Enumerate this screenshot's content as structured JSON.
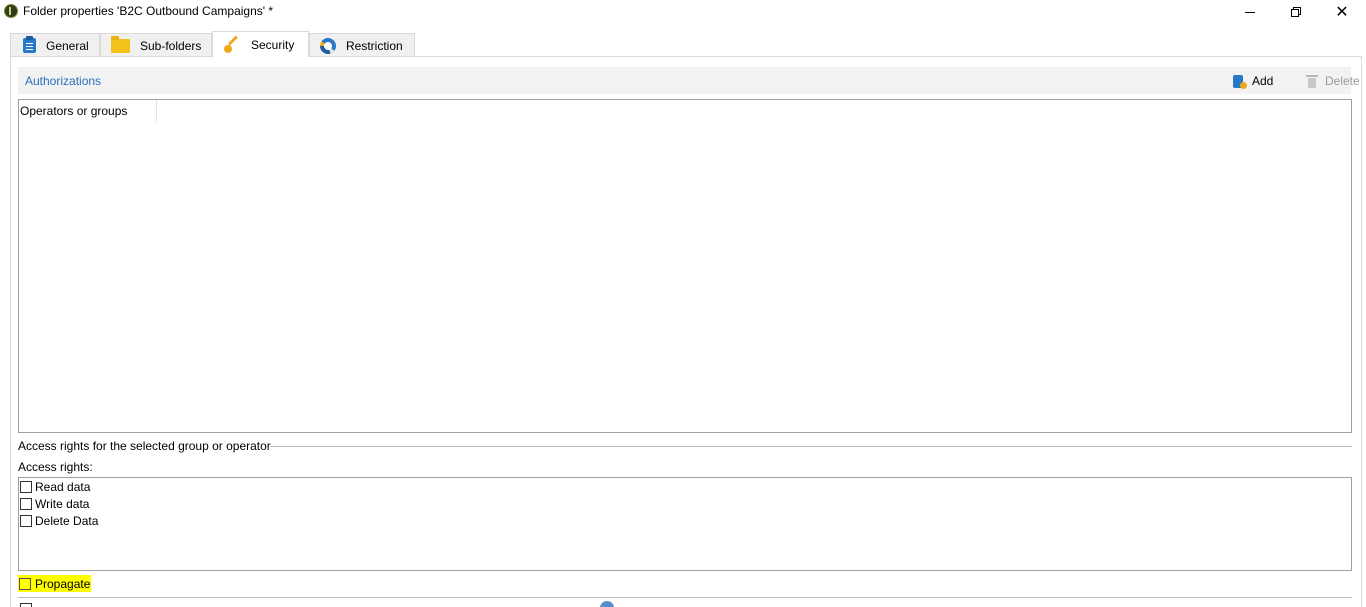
{
  "window": {
    "title": "Folder properties 'B2C Outbound Campaigns' *"
  },
  "tabs": [
    {
      "label": "General",
      "icon": "clipboard-icon"
    },
    {
      "label": "Sub-folders",
      "icon": "folder-icon"
    },
    {
      "label": "Security",
      "icon": "key-icon",
      "active": true
    },
    {
      "label": "Restriction",
      "icon": "restriction-icon"
    }
  ],
  "authorizations": {
    "title": "Authorizations",
    "add_label": "Add",
    "delete_label": "Delete",
    "column_header": "Operators or groups"
  },
  "access_rights": {
    "group_title": "Access rights for the selected group or operator",
    "label": "Access rights:",
    "items": [
      {
        "label": "Read data",
        "checked": false
      },
      {
        "label": "Write data",
        "checked": false
      },
      {
        "label": "Delete Data",
        "checked": false
      }
    ]
  },
  "propagate": {
    "label": "Propagate",
    "checked": false,
    "highlight_color": "#ffff00"
  },
  "colors": {
    "accent": "#2a6ebb",
    "toolbar_bg": "#f2f2f2"
  }
}
